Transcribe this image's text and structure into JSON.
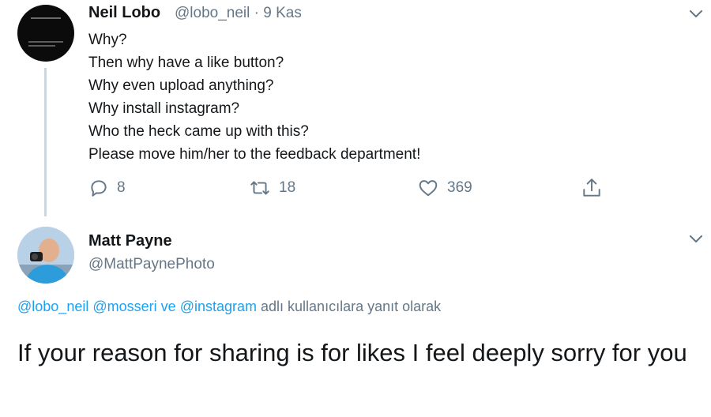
{
  "tweet1": {
    "name": "Neil Lobo",
    "handle": "@lobo_neil",
    "separator": "·",
    "date": "9 Kas",
    "lines": [
      "Why?",
      "Then why have a like button?",
      "Why even upload anything?",
      "Why install instagram?",
      "Who the heck came up with this?",
      "Please move him/her to the feedback department!"
    ],
    "reply_count": "8",
    "retweet_count": "18",
    "like_count": "369",
    "icons": [
      "reply-icon",
      "retweet-icon",
      "like-icon",
      "share-icon",
      "chevron-down-icon"
    ]
  },
  "tweet2": {
    "name": "Matt Payne",
    "handle": "@MattPaynePhoto",
    "reply_to": {
      "mention1": "@lobo_neil",
      "mention2": "@mosseri",
      "connector": "ve",
      "mention3": "@instagram",
      "suffix": "adlı kullanıcılara yanıt olarak"
    },
    "text": "If your reason for sharing is for likes I feel deeply sorry for you"
  },
  "colors": {
    "text": "#14171a",
    "muted": "#657786",
    "link": "#1da1f2",
    "thread_line": "#ccd6dd"
  }
}
